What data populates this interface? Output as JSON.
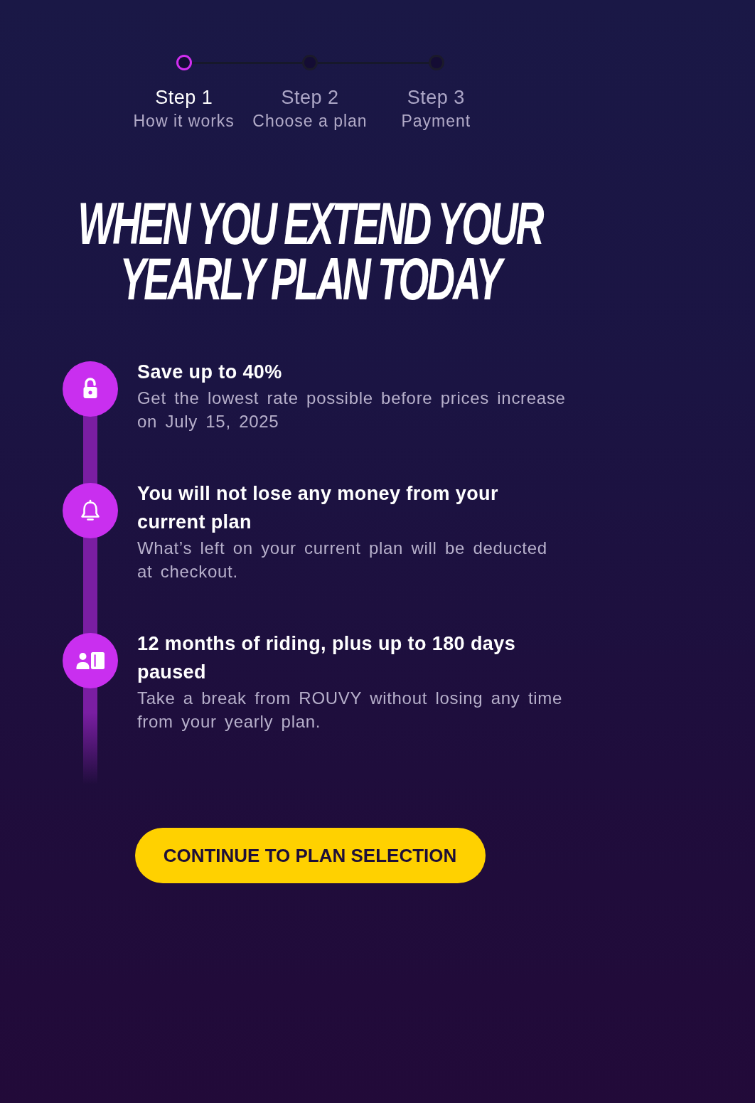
{
  "steps": [
    {
      "title": "Step 1",
      "subtitle": "How it works",
      "selected": true
    },
    {
      "title": "Step 2",
      "subtitle": "Choose a plan",
      "selected": false
    },
    {
      "title": "Step 3",
      "subtitle": "Payment",
      "selected": false
    }
  ],
  "heading": "WHEN YOU EXTEND YOUR YEARLY PLAN TODAY",
  "benefits": [
    {
      "title": "Save up to 40%",
      "description": "Get the lowest rate possible before prices increase on July 15, 2025"
    },
    {
      "title": "You will not lose any money from your current plan",
      "description": "What’s left on your current plan will be deducted at checkout."
    },
    {
      "title": "12 months of riding, plus up to 180 days paused",
      "description": "Take a break from ROUVY without losing any time from your yearly plan."
    }
  ],
  "button": {
    "label": "CONTINUE TO PLAN SELECTION"
  }
}
